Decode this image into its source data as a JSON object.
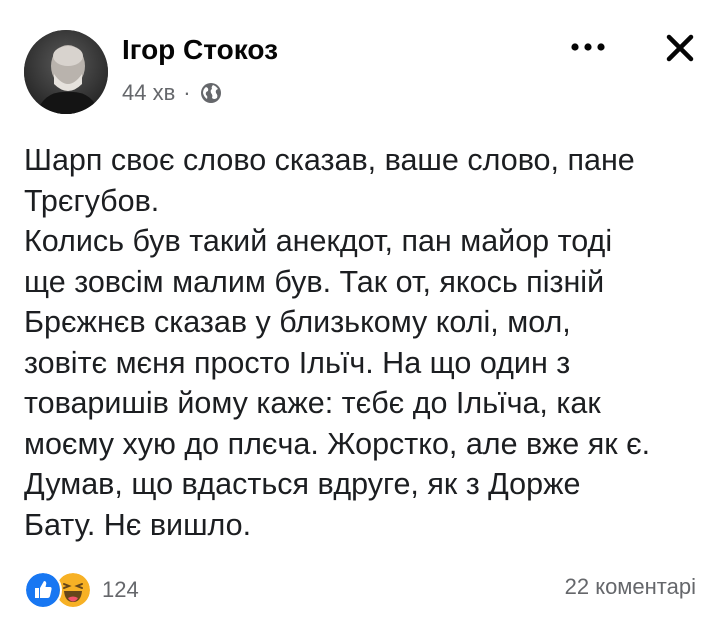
{
  "header": {
    "author": "Ігор Стокоз",
    "time": "44 хв",
    "separator": "·",
    "privacy_icon": "globe-icon",
    "more_icon": "ellipsis-icon",
    "close_icon": "close-icon"
  },
  "post": {
    "text": "Шарп своє слово сказав, ваше слово, пане\nТрєгубов.\nКолись був такий анекдот, пан майор тоді\nще зовсім малим був. Так от, якось пізній\nБрєжнєв сказав у близькому колі, мол,\nзовітє мєня просто Ільїч. На що один з\nтоваришів йому каже: тєбє до Ільїча, как\nмоєму хую до плєча. Жорстко, але вже як є.\nДумав, що вдасться вдруге, як з Дорже\nБату. Нє вишло."
  },
  "footer": {
    "reaction_icons": [
      "like-icon",
      "haha-icon"
    ],
    "reaction_count": "124",
    "comments": "22 коментарі"
  },
  "colors": {
    "text": "#1c1e21",
    "secondary": "#65676b",
    "like_blue": "#1877f2",
    "haha_yellow": "#f7b125"
  }
}
